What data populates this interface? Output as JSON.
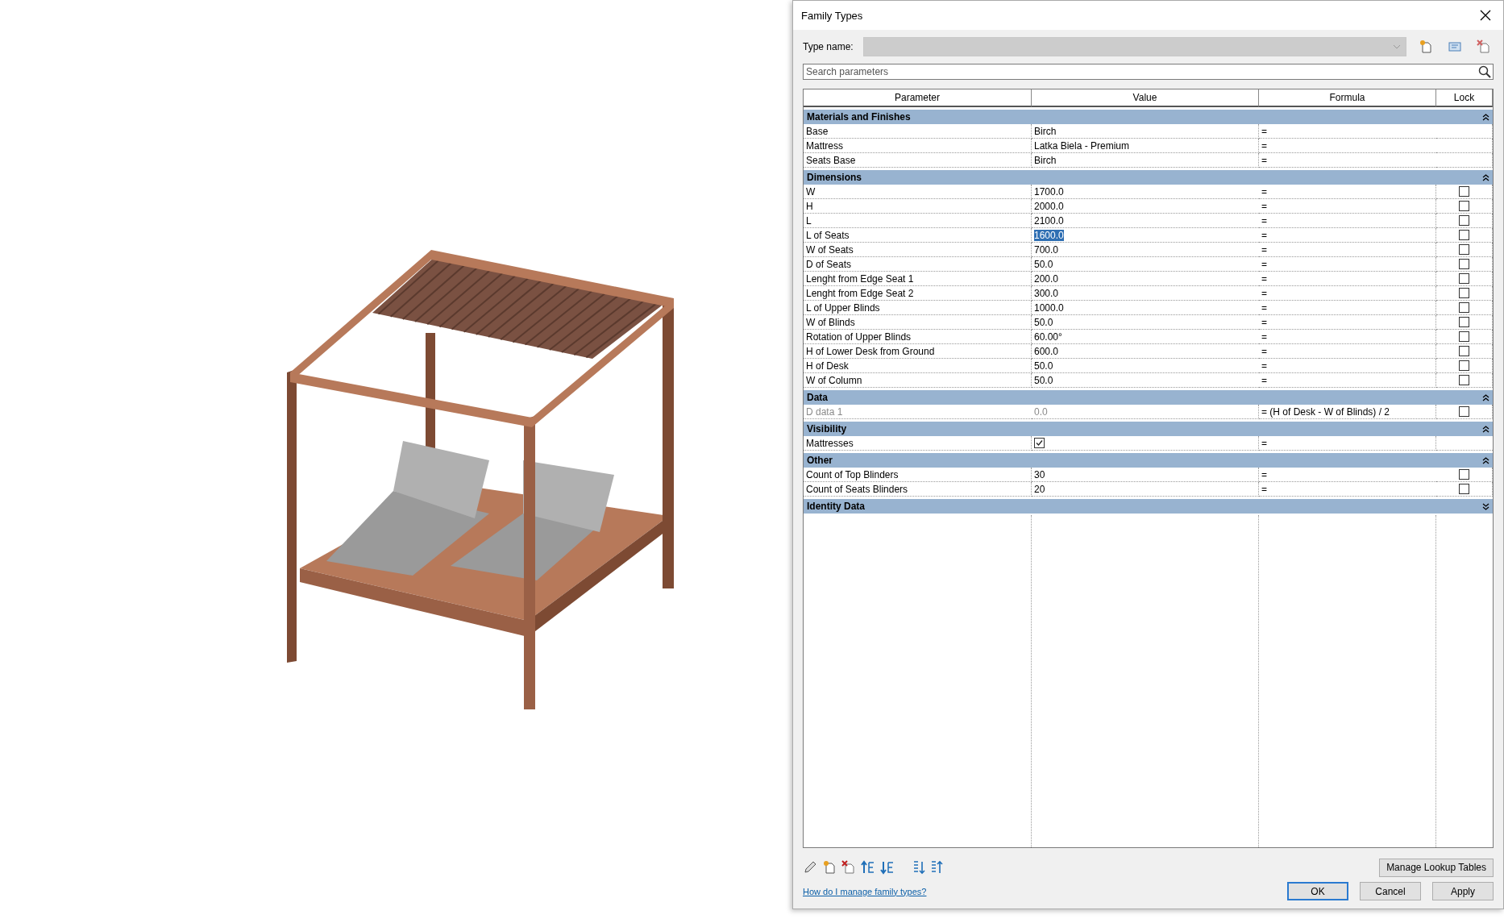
{
  "window": {
    "title": "Family Types"
  },
  "type_name": {
    "label": "Type name:",
    "disabled": true
  },
  "search": {
    "placeholder": "Search parameters"
  },
  "columns": [
    "Parameter",
    "Value",
    "Formula",
    "Lock"
  ],
  "groups": [
    {
      "title": "Materials and Finishes",
      "expanded": true,
      "rows": [
        {
          "parameter": "Base",
          "kind": "text",
          "value": "Birch",
          "formula": "="
        },
        {
          "parameter": "Mattress",
          "kind": "text",
          "value": "Latka Biela - Premium",
          "formula": "="
        },
        {
          "parameter": "Seats Base",
          "kind": "text",
          "value": "Birch",
          "formula": "="
        }
      ]
    },
    {
      "title": "Dimensions",
      "expanded": true,
      "rows": [
        {
          "parameter": "W",
          "kind": "text",
          "value": "1700.0",
          "formula": "=",
          "locked": false
        },
        {
          "parameter": "H",
          "kind": "text",
          "value": "2000.0",
          "formula": "=",
          "locked": false
        },
        {
          "parameter": "L",
          "kind": "text",
          "value": "2100.0",
          "formula": "=",
          "locked": false
        },
        {
          "parameter": "L of Seats",
          "kind": "text",
          "value": "1600.0",
          "formula": "=",
          "locked": false,
          "highlighted": true
        },
        {
          "parameter": "W of Seats",
          "kind": "text",
          "value": "700.0",
          "formula": "=",
          "locked": false
        },
        {
          "parameter": "D of Seats",
          "kind": "text",
          "value": "50.0",
          "formula": "=",
          "locked": false
        },
        {
          "parameter": "Lenght from Edge Seat 1",
          "kind": "text",
          "value": "200.0",
          "formula": "=",
          "locked": false
        },
        {
          "parameter": "Lenght from Edge Seat 2",
          "kind": "text",
          "value": "300.0",
          "formula": "=",
          "locked": false
        },
        {
          "parameter": "L of Upper Blinds",
          "kind": "text",
          "value": "1000.0",
          "formula": "=",
          "locked": false
        },
        {
          "parameter": "W of Blinds",
          "kind": "text",
          "value": "50.0",
          "formula": "=",
          "locked": false
        },
        {
          "parameter": "Rotation of Upper Blinds",
          "kind": "text",
          "value": "60.00°",
          "formula": "=",
          "locked": false
        },
        {
          "parameter": "H of Lower Desk from Ground",
          "kind": "text",
          "value": "600.0",
          "formula": "=",
          "locked": false
        },
        {
          "parameter": "H of Desk",
          "kind": "text",
          "value": "50.0",
          "formula": "=",
          "locked": false
        },
        {
          "parameter": "W of Column",
          "kind": "text",
          "value": "50.0",
          "formula": "=",
          "locked": false
        }
      ]
    },
    {
      "title": "Data",
      "expanded": true,
      "rows": [
        {
          "parameter": "D data 1",
          "kind": "text",
          "value": "0.0",
          "formula": "= (H of Desk - W of Blinds) / 2",
          "locked": false,
          "disabled": true
        }
      ]
    },
    {
      "title": "Visibility",
      "expanded": true,
      "rows": [
        {
          "parameter": "Mattresses",
          "kind": "checkbox",
          "checked": true,
          "formula": "="
        }
      ]
    },
    {
      "title": "Other",
      "expanded": true,
      "rows": [
        {
          "parameter": "Count of Top Blinders",
          "kind": "text",
          "value": "30",
          "formula": "=",
          "locked": false
        },
        {
          "parameter": "Count of Seats Blinders",
          "kind": "text",
          "value": "20",
          "formula": "=",
          "locked": false
        }
      ]
    },
    {
      "title": "Identity Data",
      "expanded": false
    }
  ],
  "link": "How do I manage family types?",
  "lookup_button": "Manage Lookup Tables",
  "buttons": [
    {
      "label": "OK",
      "default": true
    },
    {
      "label": "Cancel",
      "default": false
    },
    {
      "label": "Apply",
      "default": false
    }
  ]
}
